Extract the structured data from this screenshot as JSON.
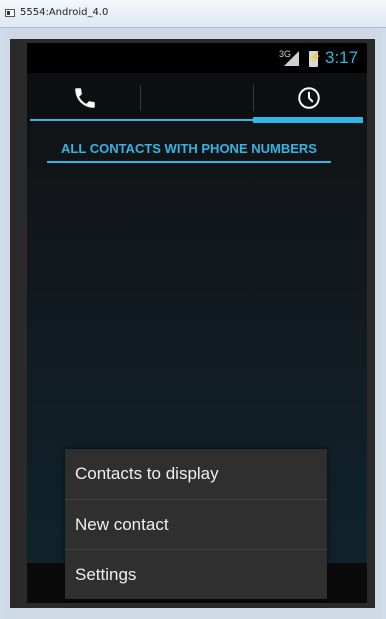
{
  "window": {
    "title": "5554:Android_4.0"
  },
  "status_bar": {
    "network": "3G",
    "time": "3:17",
    "colors": {
      "accent": "#33b5e5"
    }
  },
  "tabs": [
    {
      "icon": "phone-icon",
      "selected": false
    },
    {
      "icon": "clock-icon",
      "selected": false
    },
    {
      "icon": "star-icon",
      "selected": true
    }
  ],
  "filter": {
    "label": "ALL CONTACTS WITH PHONE NUMBERS"
  },
  "options_menu": {
    "items": [
      {
        "label": "Contacts to display"
      },
      {
        "label": "New contact"
      },
      {
        "label": "Settings"
      }
    ]
  }
}
